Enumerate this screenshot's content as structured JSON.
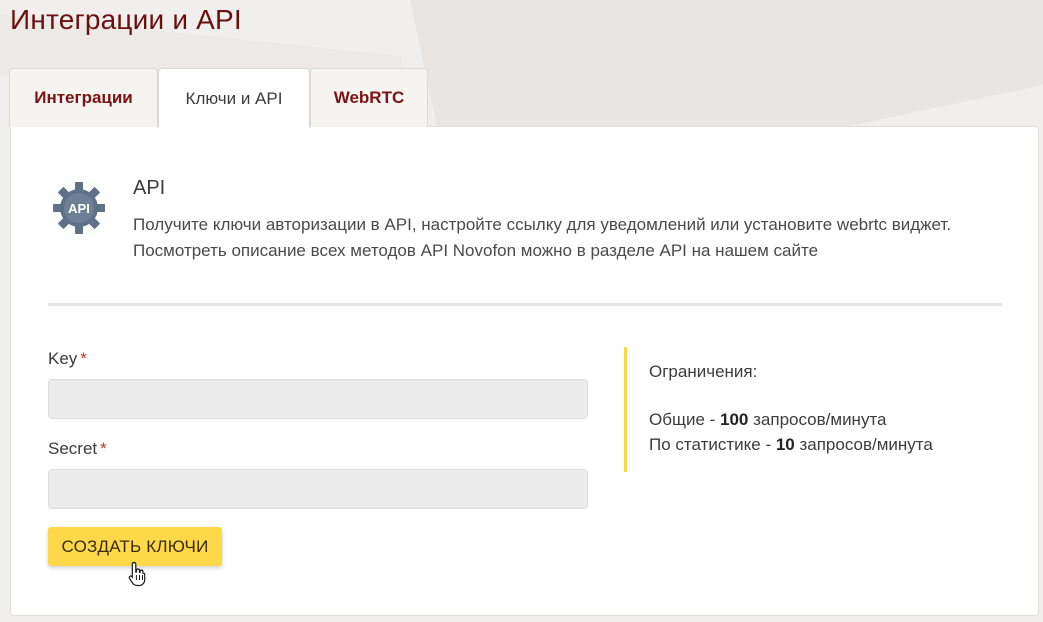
{
  "page": {
    "title": "Интеграции и API"
  },
  "tabs": [
    {
      "label": "Интеграции",
      "active": false
    },
    {
      "label": "Ключи и API",
      "active": true
    },
    {
      "label": "WebRTC",
      "active": false
    }
  ],
  "api_section": {
    "icon": "gear-api-icon",
    "icon_text": "API",
    "heading": "API",
    "description_line1": "Получите ключи авторизации в API, настройте ссылку для уведомлений или установите webrtc виджет.",
    "description_line2": "Посмотреть описание всех методов API Novofon можно в разделе API на нашем сайте"
  },
  "form": {
    "key_label": "Key",
    "secret_label": "Secret",
    "required_mark": "*",
    "key_value": "",
    "secret_value": "",
    "submit_label": "СОЗДАТЬ КЛЮЧИ"
  },
  "limits": {
    "title": "Ограничения:",
    "general_prefix": "Общие - ",
    "general_value": "100",
    "general_suffix": " запросов/минута",
    "stats_prefix": "По статистике - ",
    "stats_value": "10",
    "stats_suffix": " запросов/минута"
  },
  "colors": {
    "title": "#6b0f0f",
    "tab_text": "#7a1414",
    "button": "#fdd94a",
    "limits_border": "#f7d64c",
    "required": "#c0392b"
  }
}
